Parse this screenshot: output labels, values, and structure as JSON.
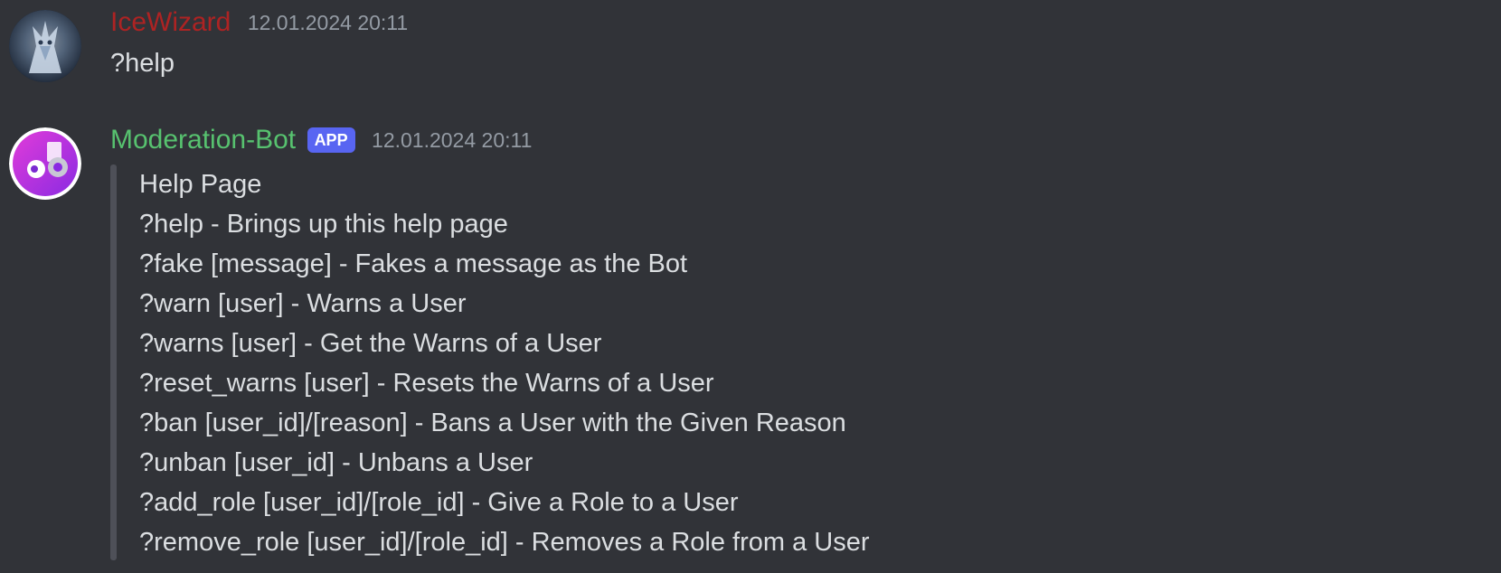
{
  "messages": [
    {
      "author": "IceWizard",
      "author_color": "#ad2323",
      "timestamp": "12.01.2024 20:11",
      "content": "?help"
    },
    {
      "author": "Moderation-Bot",
      "author_color": "#57c26f",
      "badge": "APP",
      "timestamp": "12.01.2024 20:11",
      "embed": {
        "title": "Help Page",
        "lines": [
          "?help - Brings up this help page",
          "?fake [message] - Fakes a message as the Bot",
          "?warn [user] - Warns a User",
          "?warns [user] - Get the Warns of a User",
          "?reset_warns [user] - Resets the Warns of a User",
          "?ban [user_id]/[reason] - Bans a User with the Given Reason",
          "?unban [user_id] - Unbans a User",
          "?add_role [user_id]/[role_id] - Give a Role to a User",
          "?remove_role [user_id]/[role_id] - Removes a Role from a User"
        ]
      }
    }
  ],
  "colors": {
    "background": "#313338",
    "text": "#dbdee1",
    "muted": "#949ba4",
    "badge": "#5865f2",
    "embed_bar": "#4e5058"
  },
  "icons": {
    "user_avatar": "dragon-avatar-icon",
    "bot_avatar": "bot-avatar-icon"
  }
}
